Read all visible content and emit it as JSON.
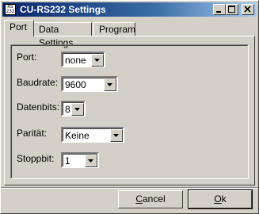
{
  "window": {
    "title": "CU-RS232 Settings",
    "icon_text": "RS\n232",
    "minimize_icon": "minimize-icon",
    "maximize_icon": "maximize-icon",
    "close_icon": "close-icon"
  },
  "tabs": [
    {
      "label": "Port",
      "active": true
    },
    {
      "label": "Data Settings",
      "active": false
    },
    {
      "label": "Program",
      "active": false
    }
  ],
  "fields": {
    "port": {
      "label": "Port:",
      "value": "none"
    },
    "baudrate": {
      "label": "Baudrate:",
      "value": "9600"
    },
    "datenbits": {
      "label": "Datenbits:",
      "value": "8"
    },
    "paritaet": {
      "label": "Parität:",
      "value": "Keine"
    },
    "stoppbit": {
      "label": "Stoppbit:",
      "value": "1"
    }
  },
  "buttons": {
    "cancel": {
      "label_first": "C",
      "label_rest": "ancel"
    },
    "ok": {
      "label_first": "O",
      "label_rest": "k"
    }
  },
  "colors": {
    "titlebar_start": "#0a246a",
    "titlebar_end": "#a6caf0",
    "face": "#d4d0c8"
  }
}
